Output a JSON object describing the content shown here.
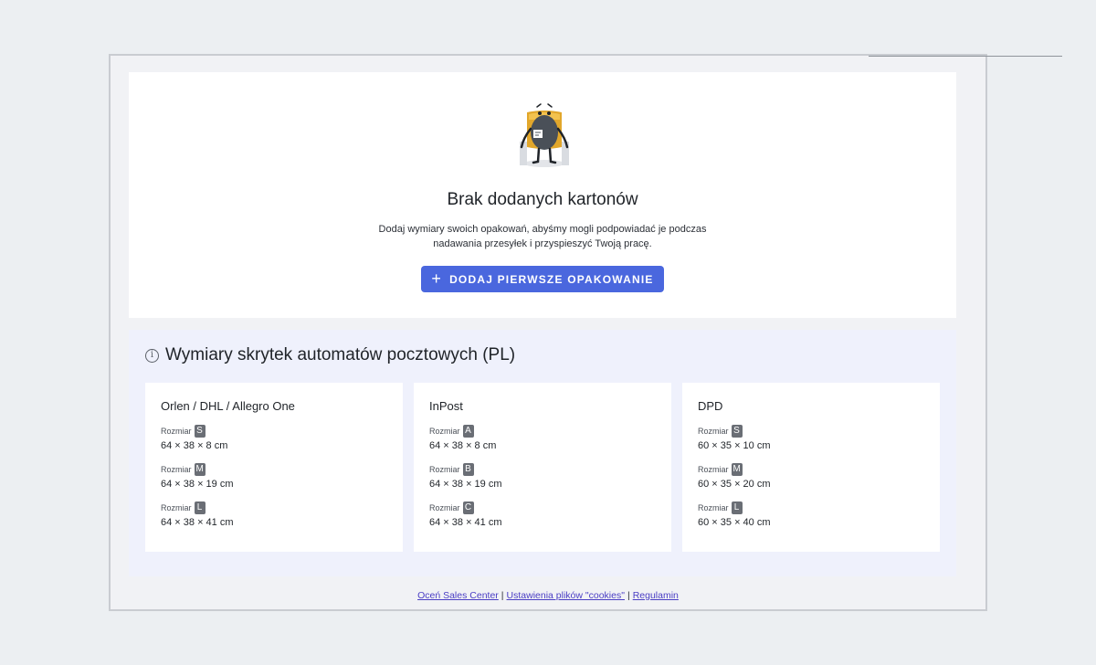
{
  "empty_state": {
    "title": "Brak dodanych kartonów",
    "description": "Dodaj wymiary swoich opakowań, abyśmy mogli podpowiadać je podczas nadawania przesyłek i przyspieszyć Twoją pracę.",
    "add_button_icon": "+",
    "add_button_label": "DODAJ PIERWSZE OPAKOWANIE"
  },
  "lockers": {
    "info_icon": "i",
    "title": "Wymiary skrytek automatów pocztowych (PL)",
    "size_word": "Rozmiar",
    "carriers": [
      {
        "name": "Orlen / DHL / Allegro One",
        "sizes": [
          {
            "code": "S",
            "dims": "64 × 38 × 8 cm"
          },
          {
            "code": "M",
            "dims": "64 × 38 × 19 cm"
          },
          {
            "code": "L",
            "dims": "64 × 38 × 41 cm"
          }
        ]
      },
      {
        "name": "InPost",
        "sizes": [
          {
            "code": "A",
            "dims": "64 × 38 × 8 cm"
          },
          {
            "code": "B",
            "dims": "64 × 38 × 19 cm"
          },
          {
            "code": "C",
            "dims": "64 × 38 × 41 cm"
          }
        ]
      },
      {
        "name": "DPD",
        "sizes": [
          {
            "code": "S",
            "dims": "60 × 35 × 10 cm"
          },
          {
            "code": "M",
            "dims": "60 × 35 × 20 cm"
          },
          {
            "code": "L",
            "dims": "60 × 35 × 40 cm"
          }
        ]
      }
    ]
  },
  "footer": {
    "rate_link": "Oceń Sales Center",
    "separator": "|",
    "cookies_link": "Ustawienia plików \"cookies\"",
    "terms_link": "Regulamin"
  },
  "colors": {
    "primary_button": "#4a67de",
    "link": "#4a3ec4",
    "badge": "#6a6e75",
    "lockers_background": "#eff1fc"
  }
}
